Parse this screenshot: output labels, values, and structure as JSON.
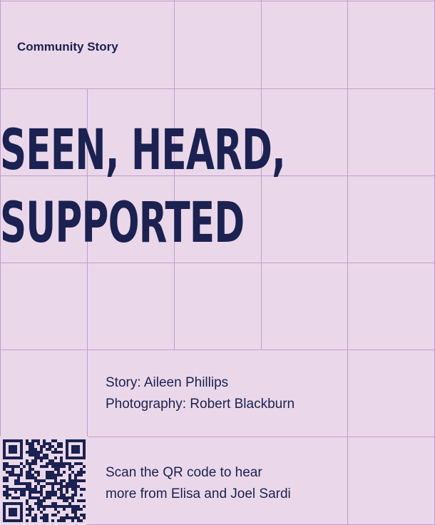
{
  "section_label": "Community Story",
  "headline": {
    "line1": "SEEN, HEARD,",
    "line2": "SUPPORTED"
  },
  "credits": {
    "story": "Story: Aileen Phillips",
    "photography": "Photography: Robert Blackburn"
  },
  "qr_caption": {
    "line1": "Scan the QR code to hear",
    "line2": "more from Elisa and Joel Sardi"
  },
  "colors": {
    "background": "#ead8ea",
    "grid": "#c39bcb",
    "text": "#1b2150"
  },
  "icons": [
    "qr-code-icon"
  ]
}
